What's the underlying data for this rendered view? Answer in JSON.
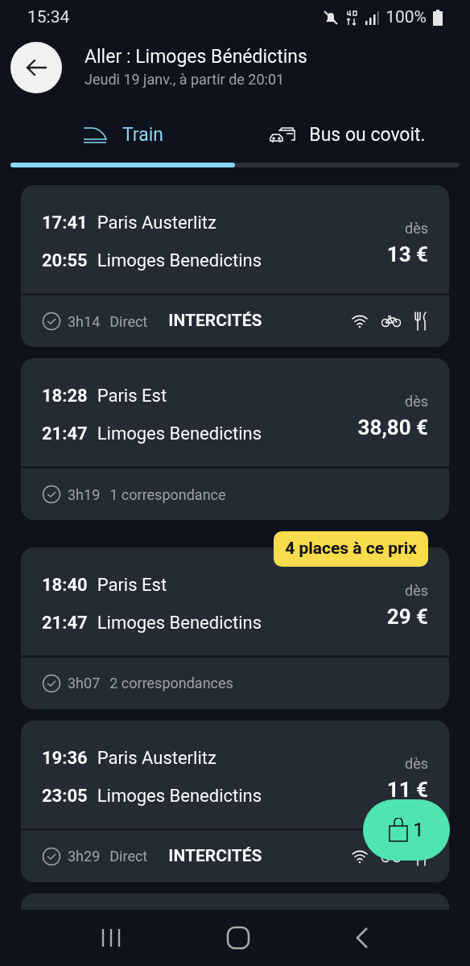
{
  "status_bar": {
    "time": "15:34",
    "battery": "100%"
  },
  "header": {
    "title": "Aller : Limoges Bénédictins",
    "subtitle": "Jeudi 19 janv., à partir de 20:01"
  },
  "tabs": [
    {
      "label": "Train",
      "kind": "train",
      "selected": true
    },
    {
      "label": "Bus ou covoit.",
      "kind": "bus",
      "selected": false
    }
  ],
  "journeys": [
    {
      "dep_time": "17:41",
      "dep_station": "Paris Austerlitz",
      "arr_time": "20:55",
      "arr_station": "Limoges Benedictins",
      "price_prefix": "dès",
      "price": "13 €",
      "duration": "3h14",
      "connections": "Direct",
      "operator": "INTERCITÉS",
      "amenities": [
        {
          "kind": "wifi"
        },
        {
          "kind": "bike"
        },
        {
          "kind": "meal"
        }
      ]
    },
    {
      "dep_time": "18:28",
      "dep_station": "Paris Est",
      "arr_time": "21:47",
      "arr_station": "Limoges Benedictins",
      "price_prefix": "dès",
      "price": "38,80 €",
      "duration": "3h19",
      "connections": "1 correspondance"
    },
    {
      "badge": "4 places à ce prix",
      "dep_time": "18:40",
      "dep_station": "Paris Est",
      "arr_time": "21:47",
      "arr_station": "Limoges Benedictins",
      "price_prefix": "dès",
      "price": "29 €",
      "duration": "3h07",
      "connections": "2 correspondances"
    },
    {
      "dep_time": "19:36",
      "dep_station": "Paris Austerlitz",
      "arr_time": "23:05",
      "arr_station": "Limoges Benedictins",
      "price_prefix": "dès",
      "price": "11 €",
      "duration": "3h29",
      "connections": "Direct",
      "operator": "INTERCITÉS",
      "amenities": [
        {
          "kind": "wifi"
        },
        {
          "kind": "bike"
        },
        {
          "kind": "meal"
        }
      ]
    }
  ],
  "cart": {
    "count": "1"
  }
}
